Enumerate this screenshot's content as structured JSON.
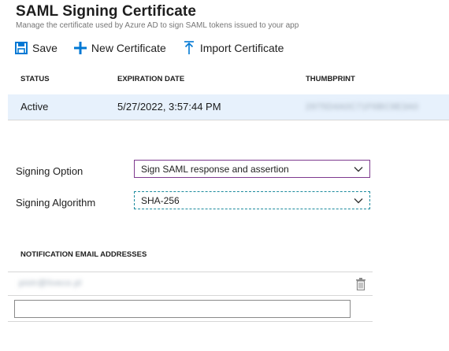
{
  "header": {
    "title": "SAML Signing Certificate",
    "subtitle": "Manage the certificate used by Azure AD to sign SAML tokens issued to your app"
  },
  "toolbar": {
    "save_label": "Save",
    "new_label": "New Certificate",
    "import_label": "Import Certificate"
  },
  "table": {
    "columns": [
      "STATUS",
      "EXPIRATION DATE",
      "THUMBPRINT"
    ],
    "rows": [
      {
        "status": "Active",
        "expiration": "5/27/2022, 3:57:44 PM",
        "thumbprint": "2975D4A0C71F6BC9E3A0"
      }
    ]
  },
  "form": {
    "signing_option_label": "Signing Option",
    "signing_option_value": "Sign SAML response and assertion",
    "signing_algorithm_label": "Signing Algorithm",
    "signing_algorithm_value": "SHA-256"
  },
  "notification": {
    "heading": "NOTIFICATION EMAIL ADDRESSES",
    "emails": [
      "piotr@liveco.pl"
    ],
    "new_email_value": ""
  },
  "colors": {
    "accent": "#0078d4",
    "selected_row": "#e7f1fc",
    "option_border": "#7e3a8e",
    "algorithm_border": "#1d8b9e"
  },
  "icons": {
    "save": "save-icon",
    "new": "plus-icon",
    "import": "upload-icon",
    "dropdown": "chevron-down-icon",
    "delete": "trash-icon"
  }
}
